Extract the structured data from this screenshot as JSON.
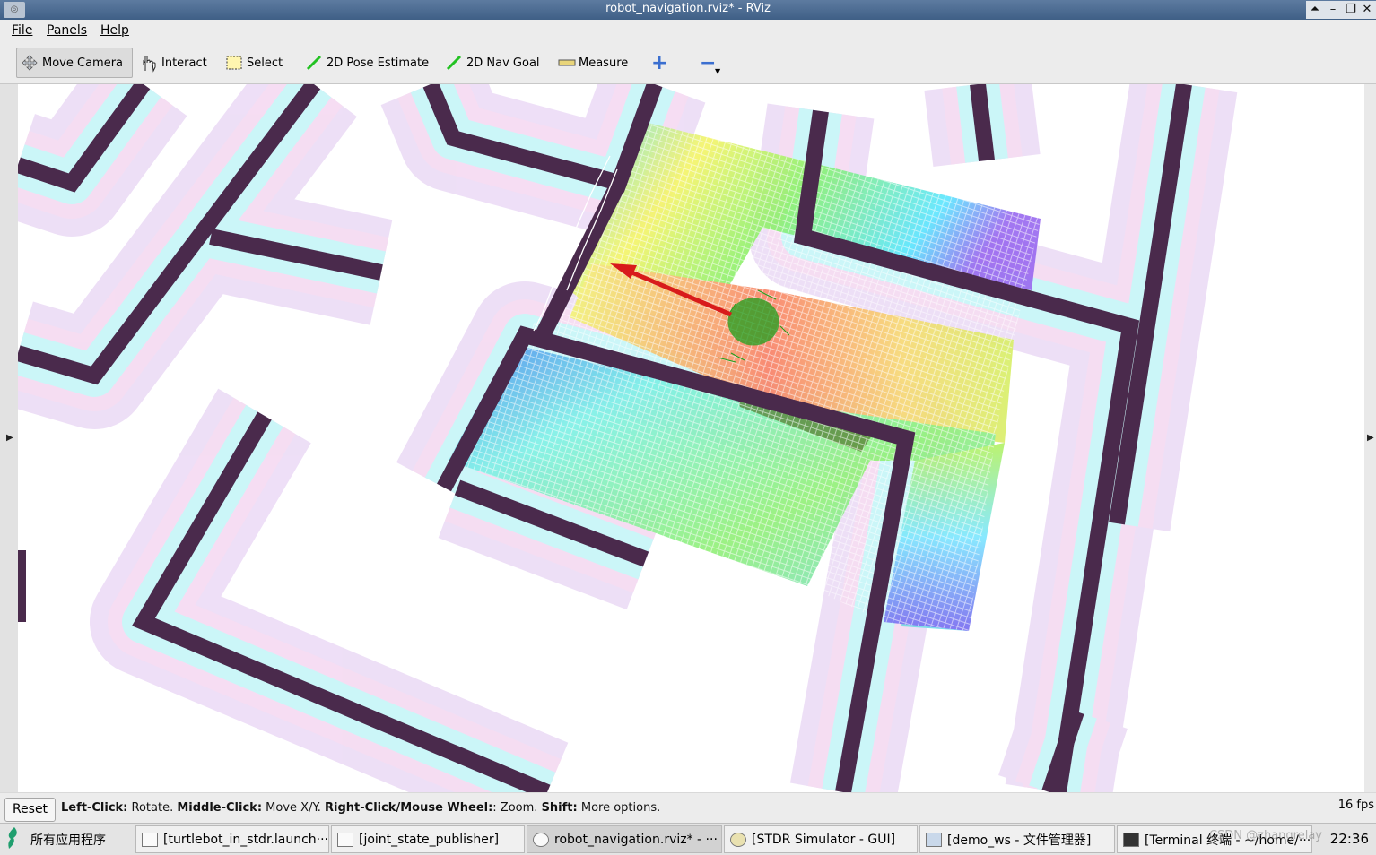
{
  "window": {
    "title": "robot_navigation.rviz* - RViz",
    "controls": [
      "⏶",
      "–",
      "❐",
      "✕"
    ]
  },
  "menu": {
    "file": "File",
    "panels": "Panels",
    "help": "Help"
  },
  "toolbar": {
    "move_camera": "Move Camera",
    "interact": "Interact",
    "select": "Select",
    "pose_estimate": "2D Pose Estimate",
    "nav_goal": "2D Nav Goal",
    "measure": "Measure",
    "add": "+",
    "remove": "−"
  },
  "status": {
    "reset": "Reset",
    "left_click": "Left-Click:",
    "left_desc": " Rotate. ",
    "middle_click": "Middle-Click:",
    "middle_desc": " Move X/Y. ",
    "right_click": "Right-Click/Mouse Wheel:",
    "right_desc": ": Zoom. ",
    "shift": "Shift:",
    "shift_desc": " More options.",
    "fps": "16 fps"
  },
  "taskbar": {
    "start_label": "所有应用程序",
    "tasks": [
      "[turtlebot_in_stdr.launch···",
      "[joint_state_publisher]",
      "robot_navigation.rviz* - ···",
      "[STDR Simulator - GUI]",
      "[demo_ws - 文件管理器]",
      "[Terminal 终端 - ~/home/···"
    ],
    "clock": "22:36",
    "watermark": "CSDN @zhangrelay"
  },
  "colors": {
    "wall": "#4a2a4c",
    "inflation_cyan": "#c9f7f9",
    "inflation_pink": "#f6dcf3",
    "inflation_lav": "#e3dcf5",
    "goal_arrow": "#d81b1b",
    "particles": "#1ea01e"
  }
}
